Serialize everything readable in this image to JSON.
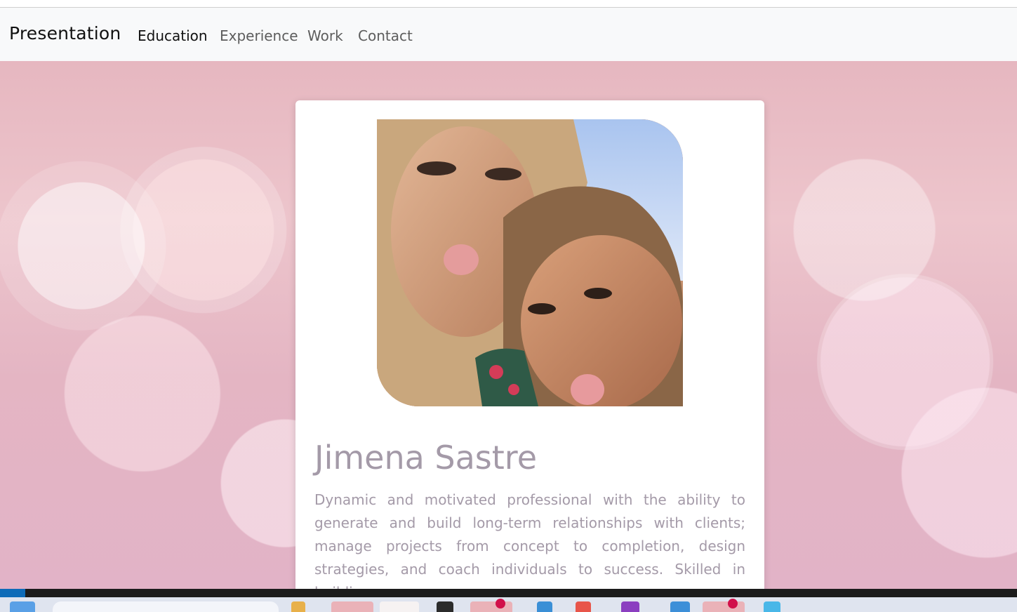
{
  "navbar": {
    "brand": "Presentation",
    "links": [
      {
        "label": "Education",
        "active": true
      },
      {
        "label": "Experience",
        "active": false
      },
      {
        "label": "Work",
        "active": false
      },
      {
        "label": "Contact",
        "active": false
      }
    ]
  },
  "profile": {
    "photo_icon": "profile-photo",
    "name": "Jimena Sastre",
    "bio": "Dynamic and motivated professional with the ability to generate and build long-term relationships with clients; manage projects from concept to completion, design strategies, and coach individuals to success. Skilled in building"
  },
  "colors": {
    "navbar_bg": "#f8f9fa",
    "text_muted": "#a49aa8",
    "hero_pink": "#e6b7c0"
  }
}
